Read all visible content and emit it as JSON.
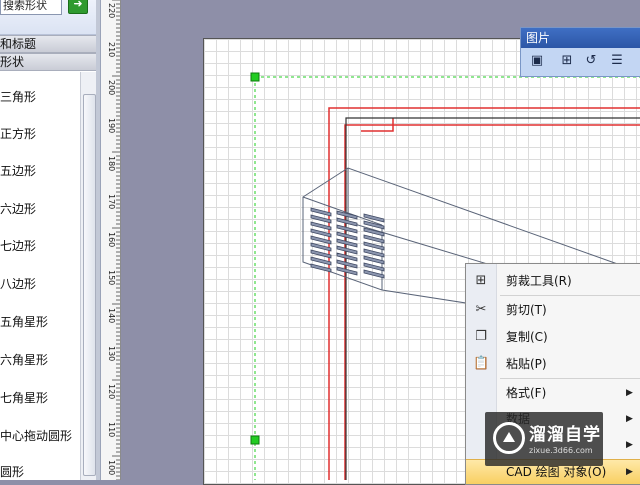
{
  "shapes_panel": {
    "search_text": "搜索形状",
    "go_icon": "arrow-right-icon",
    "stencils": [
      {
        "label": "和标题"
      },
      {
        "label": "形状"
      }
    ],
    "items": [
      {
        "label": "三角形"
      },
      {
        "label": "正方形"
      },
      {
        "label": "五边形"
      },
      {
        "label": "六边形"
      },
      {
        "label": "七边形"
      },
      {
        "label": "八边形"
      },
      {
        "label": "五角星形"
      },
      {
        "label": "六角星形"
      },
      {
        "label": "七角星形"
      },
      {
        "label": "中心拖动圆形"
      },
      {
        "label": "圆形"
      }
    ]
  },
  "ruler": {
    "labels": [
      "220",
      "210",
      "200",
      "190",
      "180",
      "170",
      "160",
      "150",
      "140",
      "130",
      "120",
      "110",
      "100"
    ]
  },
  "picture_toolbar": {
    "title": "图片",
    "buttons": [
      {
        "icon": "insert-picture-icon"
      },
      {
        "icon": "crop-icon"
      },
      {
        "icon": "rotate-icon"
      },
      {
        "icon": "line-style-icon"
      }
    ]
  },
  "context_menu": {
    "items": [
      {
        "label": "剪裁工具(R)",
        "icon": "crop-icon",
        "submenu": false
      },
      {
        "label": "剪切(T)",
        "icon": "cut-icon",
        "submenu": false
      },
      {
        "label": "复制(C)",
        "icon": "copy-icon",
        "submenu": false
      },
      {
        "label": "粘贴(P)",
        "icon": "paste-icon",
        "submenu": false
      },
      {
        "label": "格式(F)",
        "icon": "",
        "submenu": true
      },
      {
        "label": "数据",
        "icon": "",
        "submenu": true
      },
      {
        "label": "",
        "icon": "",
        "submenu": true
      },
      {
        "label": "CAD 绘图 对象(O)",
        "icon": "",
        "submenu": true,
        "highlighted": true
      }
    ]
  },
  "watermark": {
    "brand": "溜溜自学",
    "url": "zixue.3d66.com"
  },
  "colors": {
    "selection_handle": "#22cc22",
    "red_outline": "#e03030",
    "drawing_lines": "#5a6478",
    "menu_highlight": "#f8cf62",
    "toolbar_title": "#2c56a6"
  }
}
